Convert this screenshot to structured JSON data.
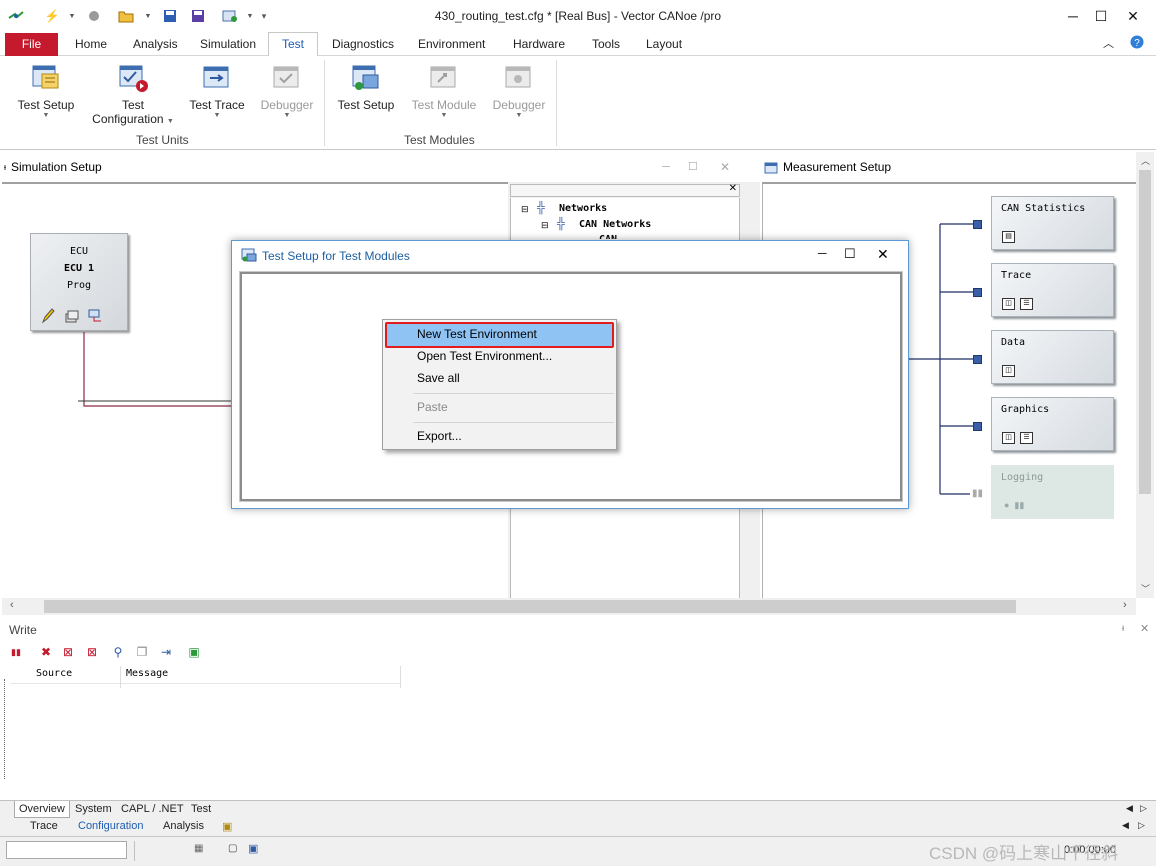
{
  "window": {
    "title": "430_routing_test.cfg * [Real Bus] - Vector CANoe /pro"
  },
  "menubar": {
    "file": "File",
    "home": "Home",
    "analysis": "Analysis",
    "simulation": "Simulation",
    "test": "Test",
    "diagnostics": "Diagnostics",
    "environment": "Environment",
    "hardware": "Hardware",
    "tools": "Tools",
    "layout": "Layout"
  },
  "ribbon": {
    "test_setup": "Test Setup",
    "test_configuration_1": "Test",
    "test_configuration_2": "Configuration",
    "test_trace": "Test Trace",
    "debugger": "Debugger",
    "group_test_units": "Test Units",
    "tm_test_setup": "Test Setup",
    "tm_test_module": "Test Module",
    "tm_debugger": "Debugger",
    "group_test_modules": "Test Modules"
  },
  "sim": {
    "title": "Simulation Setup",
    "ecu_line1": "ECU",
    "ecu_line2": "ECU 1",
    "ecu_line3": "Prog"
  },
  "tree": {
    "networks": "Networks",
    "can_networks": "CAN Networks",
    "can": "CAN"
  },
  "meas": {
    "title": "Measurement Setup",
    "blocks": [
      "CAN Statistics",
      "Trace",
      "Data",
      "Graphics",
      "Logging"
    ]
  },
  "dialog": {
    "title": "Test Setup for Test Modules"
  },
  "context_menu": {
    "new_env": "New Test Environment",
    "open_env": "Open Test Environment...",
    "save_all": "Save all",
    "paste": "Paste",
    "export": "Export..."
  },
  "write": {
    "title": "Write",
    "col_source": "Source",
    "col_message": "Message"
  },
  "tabs_bottom": [
    "Overview",
    "System",
    "CAPL / .NET",
    "Test"
  ],
  "tabs_desktop": [
    "Trace",
    "Configuration",
    "Analysis"
  ],
  "status": {
    "time": "0:00:00:00",
    "watermark": "CSDN @码上寒山千径斜"
  },
  "colors": {
    "file_red": "#c5192d",
    "accent_blue": "#1e5cb3",
    "highlight": "#8fc3f4",
    "highlight_border": "#e21c1c"
  }
}
